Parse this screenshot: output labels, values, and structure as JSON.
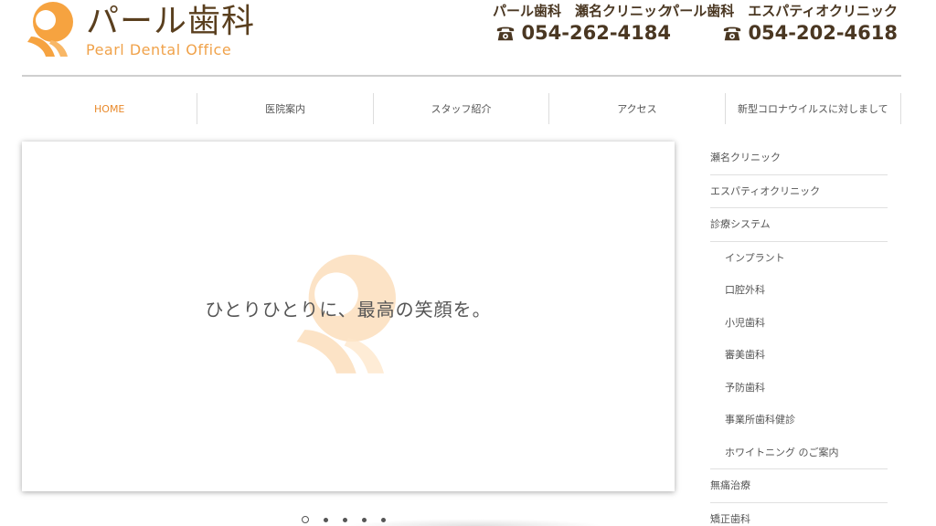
{
  "header": {
    "logo_title": "パール歯科",
    "logo_subtitle": "Pearl  Dental Office",
    "clinics": [
      {
        "name": "パール歯科　瀬名クリニック",
        "phone": "054-262-4184"
      },
      {
        "name": "パール歯科　エスパティオクリニック",
        "phone": "054-202-4618"
      }
    ]
  },
  "nav": {
    "items": [
      {
        "label": "HOME"
      },
      {
        "label": "医院案内"
      },
      {
        "label": "スタッフ紹介"
      },
      {
        "label": "アクセス"
      },
      {
        "label": "新型コロナウイルスに対しまして"
      }
    ]
  },
  "slider": {
    "caption": "ひとりひとりに、最高の笑顔を。",
    "slide_count": 5,
    "active_slide": 1
  },
  "side_menu": {
    "items": [
      {
        "label": "瀬名クリニック"
      },
      {
        "label": "エスパティオクリニック"
      },
      {
        "label": "診療システム"
      },
      {
        "label": "インプラント"
      },
      {
        "label": "口腔外科"
      },
      {
        "label": "小児歯科"
      },
      {
        "label": "審美歯科"
      },
      {
        "label": "予防歯科"
      },
      {
        "label": "事業所歯科健診"
      },
      {
        "label": "ホワイトニング のご案内"
      },
      {
        "label": "無痛治療"
      },
      {
        "label": "矯正歯科"
      }
    ]
  },
  "colors": {
    "accent": "#e9892a",
    "logo_orange": "#f0a24a",
    "brown_text": "#4a3722"
  }
}
